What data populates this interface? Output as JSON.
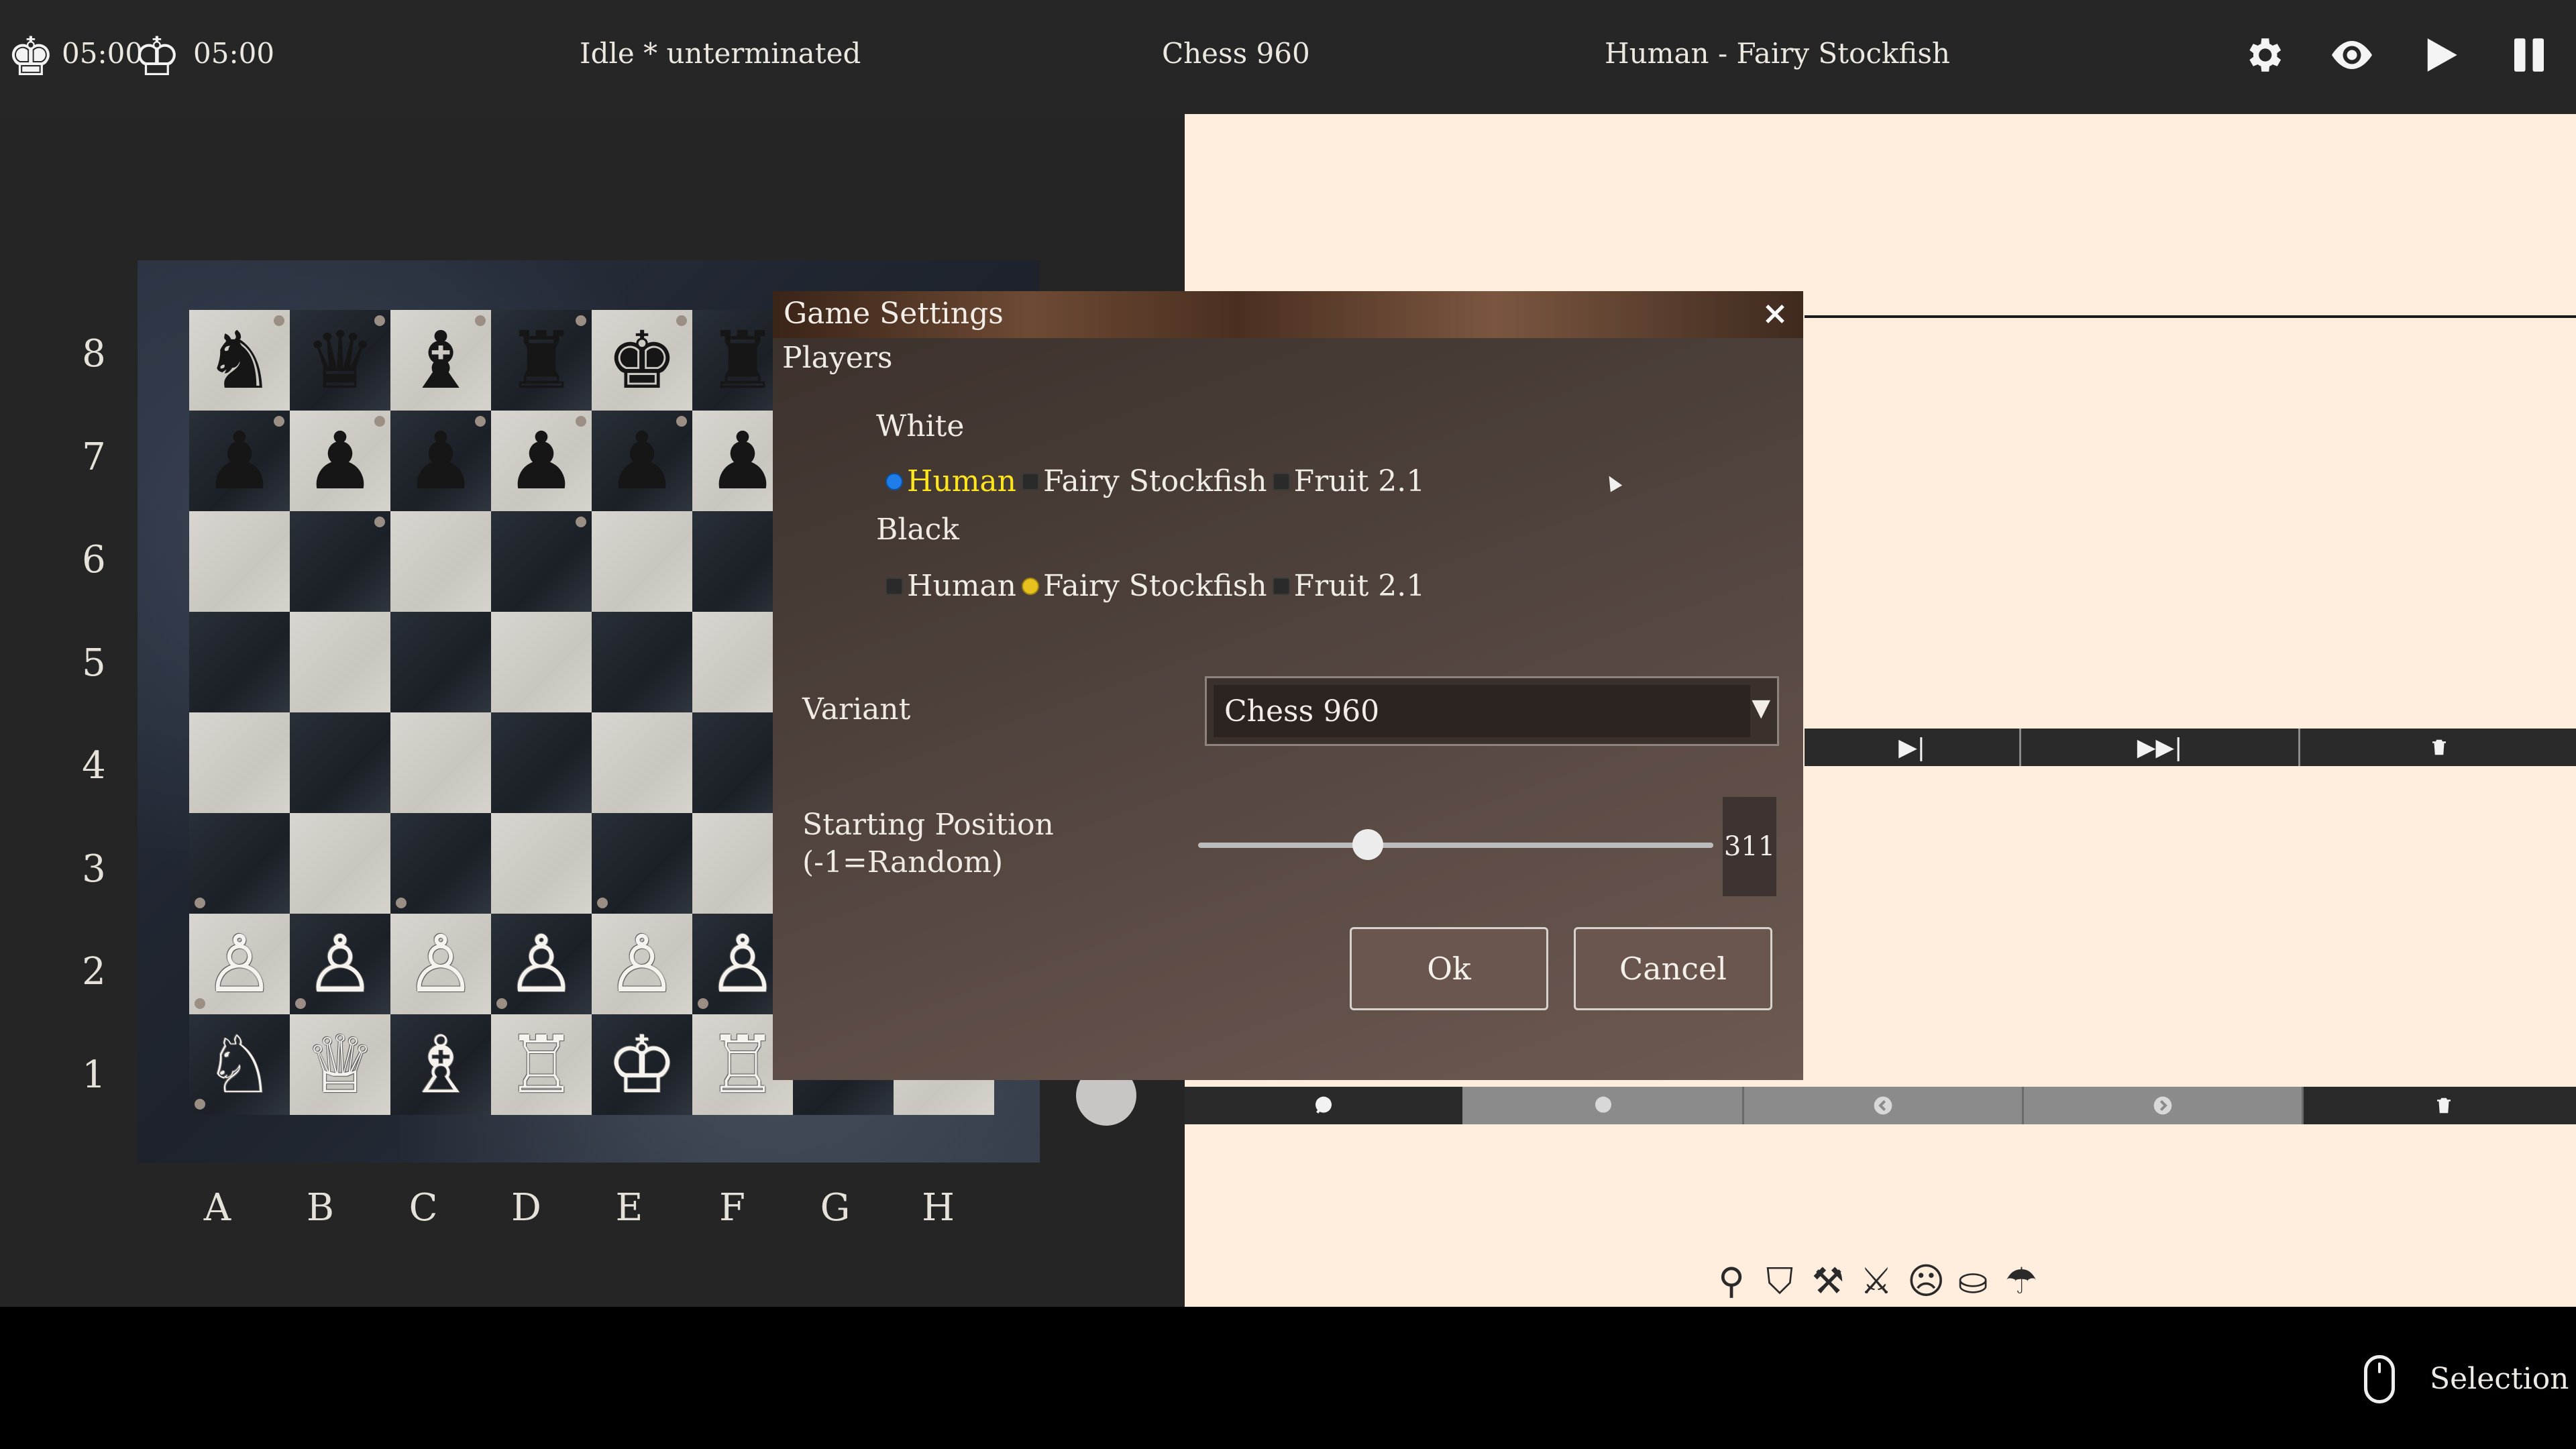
{
  "topbar": {
    "white_clock": "05:00",
    "black_clock": "05:00",
    "status": "Idle  *  unterminated",
    "variant": "Chess 960",
    "players": "Human - Fairy Stockfish",
    "icons": [
      "gear-icon",
      "eye-icon",
      "play-icon",
      "pause-icon"
    ]
  },
  "board": {
    "ranks": [
      "8",
      "7",
      "6",
      "5",
      "4",
      "3",
      "2",
      "1"
    ],
    "files": [
      "A",
      "B",
      "C",
      "D",
      "E",
      "F",
      "G",
      "H"
    ],
    "rows": [
      [
        "♞",
        "♛",
        "♝",
        "♜",
        "♚",
        "♜",
        "",
        ""
      ],
      [
        "♟",
        "♟",
        "♟",
        "♟",
        "♟",
        "♟",
        "",
        ""
      ],
      [
        "",
        "",
        "",
        "",
        "",
        "",
        "",
        ""
      ],
      [
        "",
        "",
        "",
        "",
        "",
        "",
        "",
        ""
      ],
      [
        "",
        "",
        "",
        "",
        "",
        "",
        "",
        ""
      ],
      [
        "",
        "",
        "",
        "",
        "",
        "",
        "",
        ""
      ],
      [
        "♙",
        "♙",
        "♙",
        "♙",
        "♙",
        "♙",
        "",
        ""
      ],
      [
        "♘",
        "♕",
        "♗",
        "♖",
        "♔",
        "♖",
        "",
        ""
      ]
    ]
  },
  "dialog": {
    "title": "Game Settings",
    "section": "Players",
    "white_label": "White",
    "white_options": [
      "Human",
      "Fairy Stockfish",
      "Fruit 2.1"
    ],
    "white_selected": "Human",
    "black_label": "Black",
    "black_options": [
      "Human",
      "Fairy Stockfish",
      "Fruit 2.1"
    ],
    "black_selected": "Fairy Stockfish",
    "variant_label": "Variant",
    "variant_value": "Chess 960",
    "start_label_line1": "Starting Position",
    "start_label_line2": "(-1=Random)",
    "start_value": "311",
    "start_slider_fraction": 0.33,
    "ok": "Ok",
    "cancel": "Cancel"
  },
  "statusbar": {
    "mode": "Selection"
  },
  "colors": {
    "accent_blue": "#1e7de8",
    "accent_yellow": "#e7c21f",
    "panel_bg": "#ffeedd"
  }
}
